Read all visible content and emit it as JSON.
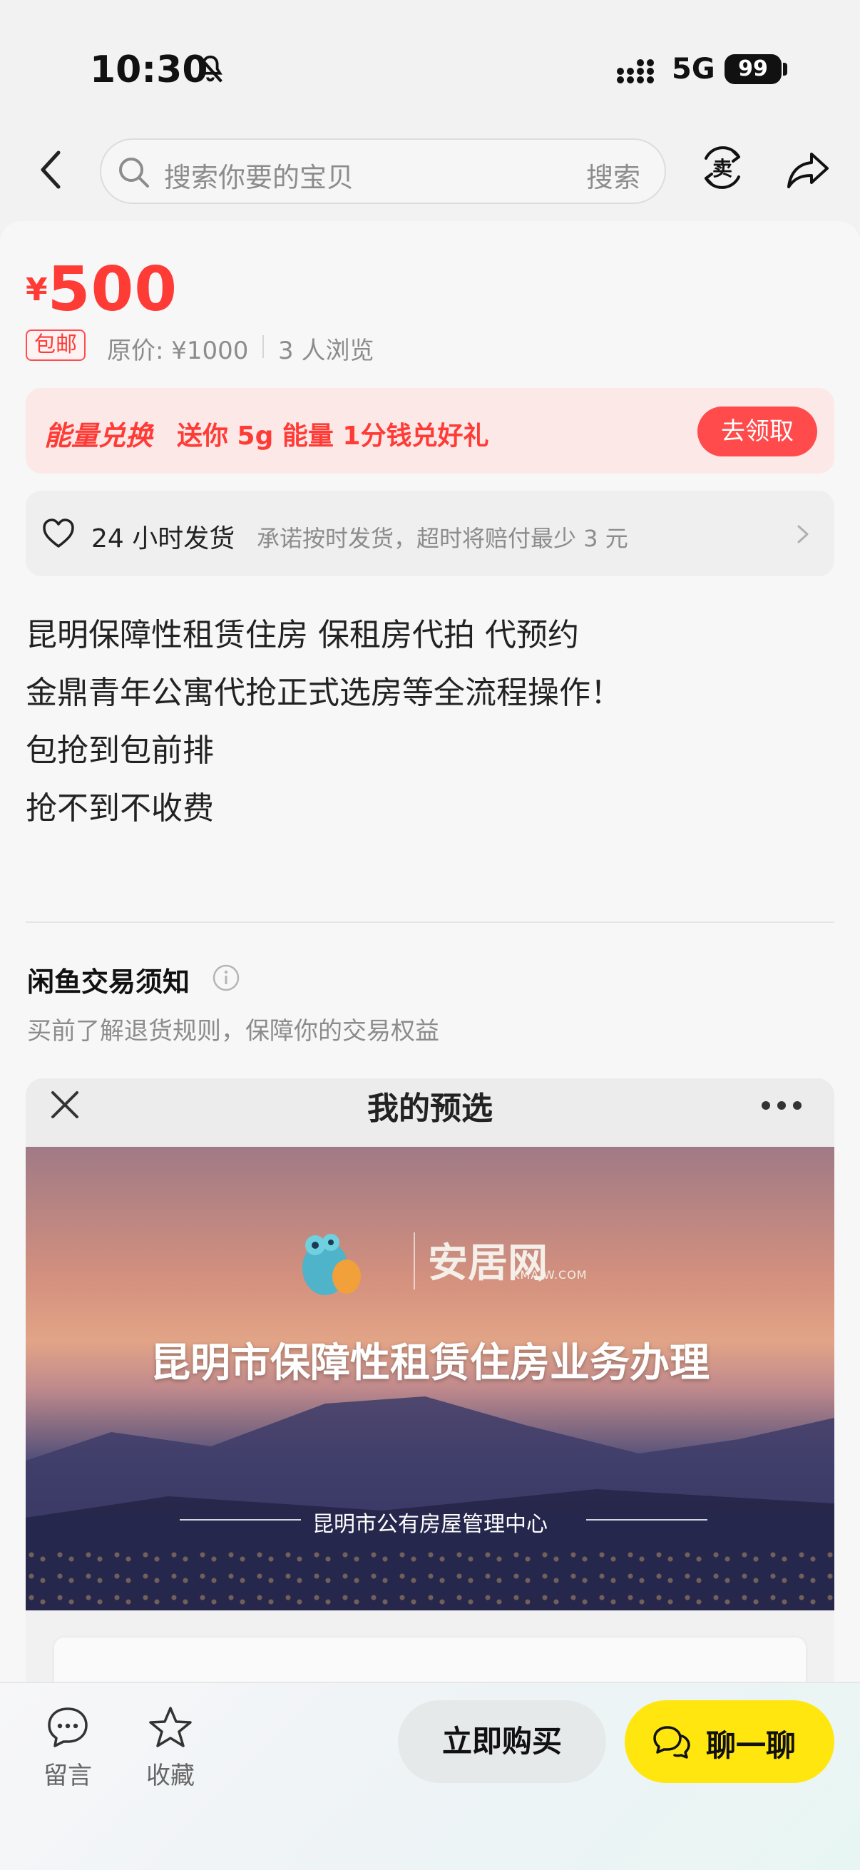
{
  "status": {
    "time": "10:30",
    "network": "5G",
    "battery": "99"
  },
  "search": {
    "placeholder": "搜索你要的宝贝",
    "action": "搜索"
  },
  "product": {
    "currency": "¥",
    "price": "500",
    "free_shipping_tag": "包邮",
    "original_price": "原价: ¥1000",
    "views": "3 人浏览"
  },
  "energy": {
    "title": "能量兑换",
    "desc": "送你 5g 能量 1分钱兑好礼",
    "button": "去领取"
  },
  "shipping": {
    "title": "24 小时发货",
    "desc": "承诺按时发货，超时将赔付最少 3 元"
  },
  "description": {
    "lines": [
      "昆明保障性租赁住房 保租房代拍 代预约",
      "金鼎青年公寓代抢正式选房等全流程操作！",
      "包抢到包前排",
      "抢不到不收费"
    ]
  },
  "notice": {
    "title": "闲鱼交易须知",
    "subtitle": "买前了解退货规则，保障你的交易权益"
  },
  "listing_image": {
    "header_title": "我的预选",
    "logo_text": "安居网",
    "logo_sub": "KMAJW.COM",
    "banner_title": "昆明市保障性租赁住房业务办理",
    "banner_sub": "昆明市公有房屋管理中心"
  },
  "bottom": {
    "comment": "留言",
    "favorite": "收藏",
    "buy": "立即购买",
    "chat": "聊一聊"
  },
  "colors": {
    "price_red": "#ff3b36",
    "chat_yellow": "#ffe60f",
    "energy_bg": "#fde8e8"
  }
}
